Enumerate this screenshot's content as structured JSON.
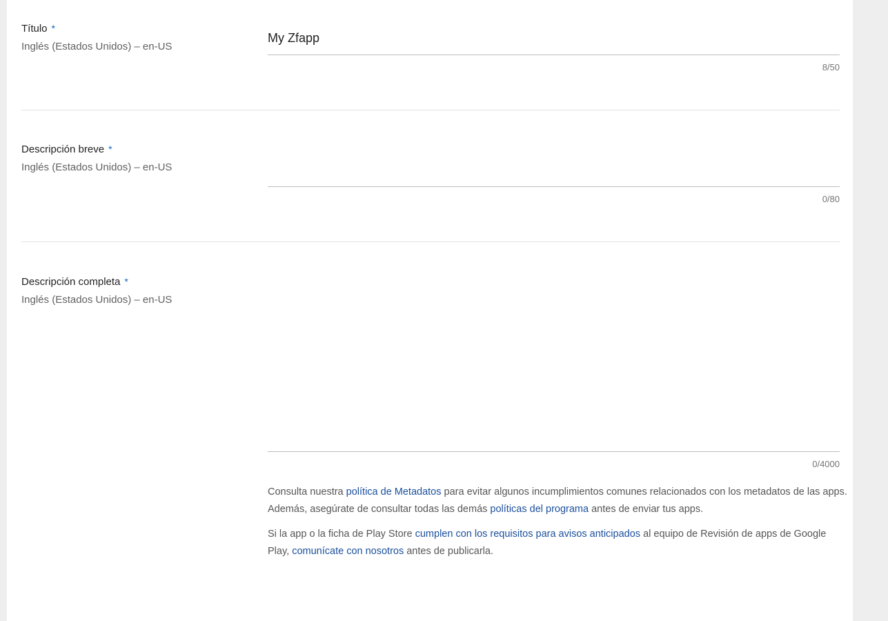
{
  "fields": {
    "title": {
      "label": "Título",
      "required_mark": "*",
      "language": "Inglés (Estados Unidos) – en-US",
      "value": "My Zfapp",
      "counter": "8/50"
    },
    "short_description": {
      "label": "Descripción breve",
      "required_mark": "*",
      "language": "Inglés (Estados Unidos) – en-US",
      "value": "",
      "counter": "0/80"
    },
    "full_description": {
      "label": "Descripción completa",
      "required_mark": "*",
      "language": "Inglés (Estados Unidos) – en-US",
      "value": "",
      "counter": "0/4000"
    }
  },
  "help": {
    "p1": {
      "t1": "Consulta nuestra ",
      "link1": "política de Metadatos",
      "t2": " para evitar algunos incumplimientos comunes relacionados con los metadatos de las apps. Además, asegúrate de consultar todas las demás ",
      "link2": "políticas del programa",
      "t3": " antes de enviar tus apps."
    },
    "p2": {
      "t1": "Si la app o la ficha de Play Store ",
      "link1": "cumplen con los requisitos para avisos anticipados",
      "t2": " al equipo de Revisión de apps de Google Play, ",
      "link2": "comunícate con nosotros",
      "t3": " antes de publicarla."
    }
  },
  "colors": {
    "accent": "#1565c0",
    "link": "#1a4f9c",
    "background": "#eeeeee",
    "panel": "#ffffff"
  }
}
